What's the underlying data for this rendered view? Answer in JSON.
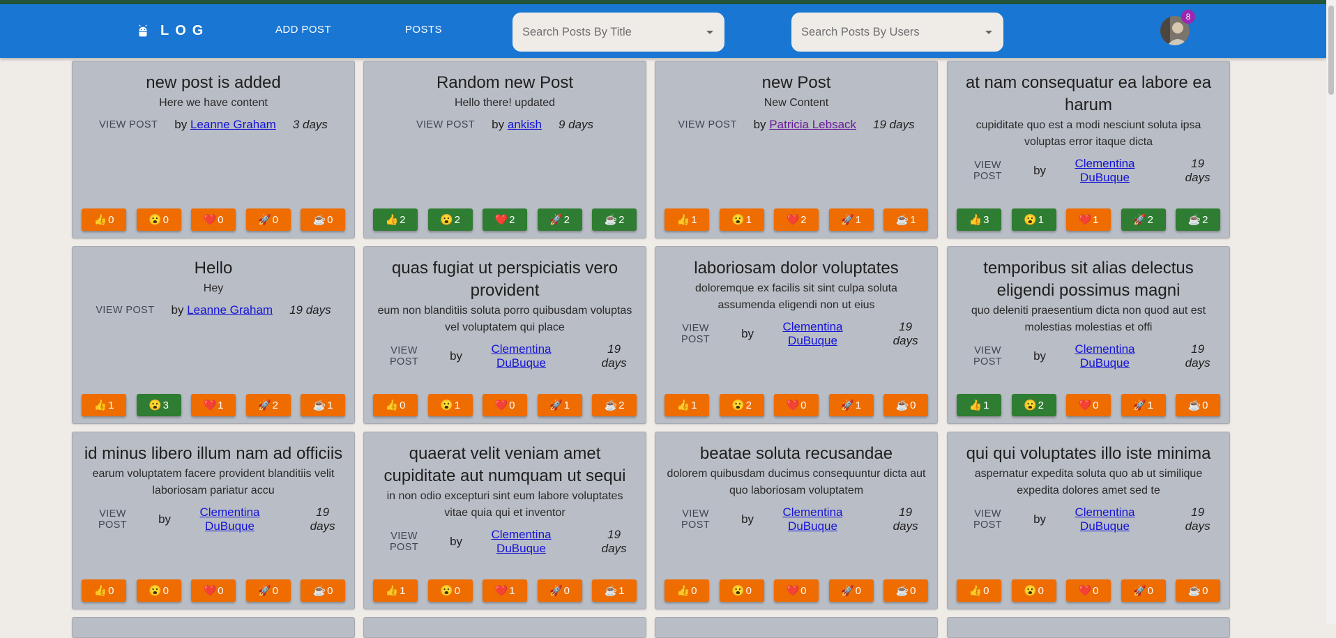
{
  "header": {
    "logo_text": "LOG",
    "nav": {
      "add_post": "ADD POST",
      "posts": "POSTS"
    },
    "search_title_placeholder": "Search Posts By Title",
    "search_users_placeholder": "Search Posts By Users",
    "notification_count": "8"
  },
  "colors": {
    "appbar": "#1976d2",
    "reaction_default": "#ef6c00",
    "reaction_active": "#2e7d32",
    "badge": "#9c27b0"
  },
  "reaction_icons": [
    "👍",
    "😮",
    "❤️",
    "🚀",
    "☕"
  ],
  "view_post_label": "VIEW POST",
  "by_label": "by",
  "posts": [
    {
      "title": "new post is added",
      "body": "Here we have content",
      "author": "Leanne Graham",
      "age": "3 days",
      "reactions": [
        {
          "count": "0",
          "active": false
        },
        {
          "count": "0",
          "active": false
        },
        {
          "count": "0",
          "active": false
        },
        {
          "count": "0",
          "active": false
        },
        {
          "count": "0",
          "active": false
        }
      ]
    },
    {
      "title": "Random new Post",
      "body": "Hello there! updated",
      "author": "ankish",
      "age": "9 days",
      "reactions": [
        {
          "count": "2",
          "active": true
        },
        {
          "count": "2",
          "active": true
        },
        {
          "count": "2",
          "active": true
        },
        {
          "count": "2",
          "active": true
        },
        {
          "count": "2",
          "active": true
        }
      ]
    },
    {
      "title": "new Post",
      "body": "New Content",
      "author": "Patricia Lebsack",
      "age": "19 days",
      "visited": true,
      "reactions": [
        {
          "count": "1",
          "active": false
        },
        {
          "count": "1",
          "active": false
        },
        {
          "count": "2",
          "active": false
        },
        {
          "count": "1",
          "active": false
        },
        {
          "count": "1",
          "active": false
        }
      ]
    },
    {
      "title": "at nam consequatur ea labore ea harum",
      "body": "cupiditate quo est a modi nesciunt soluta ipsa voluptas error itaque dicta",
      "author": "Clementina DuBuque",
      "age": "19 days",
      "reactions": [
        {
          "count": "3",
          "active": true
        },
        {
          "count": "1",
          "active": true
        },
        {
          "count": "1",
          "active": false
        },
        {
          "count": "2",
          "active": true
        },
        {
          "count": "2",
          "active": true
        }
      ]
    },
    {
      "title": "Hello",
      "body": "Hey",
      "author": "Leanne Graham",
      "age": "19 days",
      "reactions": [
        {
          "count": "1",
          "active": false
        },
        {
          "count": "3",
          "active": true
        },
        {
          "count": "1",
          "active": false
        },
        {
          "count": "2",
          "active": false
        },
        {
          "count": "1",
          "active": false
        }
      ]
    },
    {
      "title": "quas fugiat ut perspiciatis vero provident",
      "body": "eum non blanditiis soluta porro quibusdam voluptas vel voluptatem qui place",
      "author": "Clementina DuBuque",
      "age": "19 days",
      "reactions": [
        {
          "count": "0",
          "active": false
        },
        {
          "count": "1",
          "active": false
        },
        {
          "count": "0",
          "active": false
        },
        {
          "count": "1",
          "active": false
        },
        {
          "count": "2",
          "active": false
        }
      ]
    },
    {
      "title": "laboriosam dolor voluptates",
      "body": "doloremque ex facilis sit sint culpa soluta assumenda eligendi non ut eius",
      "author": "Clementina DuBuque",
      "age": "19 days",
      "reactions": [
        {
          "count": "1",
          "active": false
        },
        {
          "count": "2",
          "active": false
        },
        {
          "count": "0",
          "active": false
        },
        {
          "count": "1",
          "active": false
        },
        {
          "count": "0",
          "active": false
        }
      ]
    },
    {
      "title": "temporibus sit alias delectus eligendi possimus magni",
      "body": "quo deleniti praesentium dicta non quod aut est molestias molestias et offi",
      "author": "Clementina DuBuque",
      "age": "19 days",
      "reactions": [
        {
          "count": "1",
          "active": true
        },
        {
          "count": "2",
          "active": true
        },
        {
          "count": "0",
          "active": false
        },
        {
          "count": "1",
          "active": false
        },
        {
          "count": "0",
          "active": false
        }
      ]
    },
    {
      "title": "id minus libero illum nam ad officiis",
      "body": "earum voluptatem facere provident blanditiis velit laboriosam pariatur accu",
      "author": "Clementina DuBuque",
      "age": "19 days",
      "reactions": [
        {
          "count": "0",
          "active": false
        },
        {
          "count": "0",
          "active": false
        },
        {
          "count": "0",
          "active": false
        },
        {
          "count": "0",
          "active": false
        },
        {
          "count": "0",
          "active": false
        }
      ]
    },
    {
      "title": "quaerat velit veniam amet cupiditate aut numquam ut sequi",
      "body": "in non odio excepturi sint eum labore voluptates vitae quia qui et inventor",
      "author": "Clementina DuBuque",
      "age": "19 days",
      "reactions": [
        {
          "count": "1",
          "active": false
        },
        {
          "count": "0",
          "active": false
        },
        {
          "count": "1",
          "active": false
        },
        {
          "count": "0",
          "active": false
        },
        {
          "count": "1",
          "active": false
        }
      ]
    },
    {
      "title": "beatae soluta recusandae",
      "body": "dolorem quibusdam ducimus consequuntur dicta aut quo laboriosam voluptatem",
      "author": "Clementina DuBuque",
      "age": "19 days",
      "reactions": [
        {
          "count": "0",
          "active": false
        },
        {
          "count": "0",
          "active": false
        },
        {
          "count": "0",
          "active": false
        },
        {
          "count": "0",
          "active": false
        },
        {
          "count": "0",
          "active": false
        }
      ]
    },
    {
      "title": "qui qui voluptates illo iste minima",
      "body": "aspernatur expedita soluta quo ab ut similique expedita dolores amet sed te",
      "author": "Clementina DuBuque",
      "age": "19 days",
      "reactions": [
        {
          "count": "0",
          "active": false
        },
        {
          "count": "0",
          "active": false
        },
        {
          "count": "0",
          "active": false
        },
        {
          "count": "0",
          "active": false
        },
        {
          "count": "0",
          "active": false
        }
      ]
    }
  ]
}
